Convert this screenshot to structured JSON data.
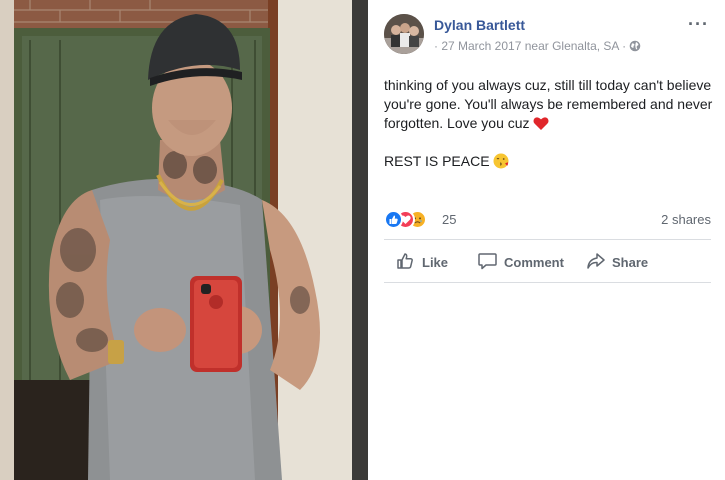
{
  "post": {
    "author": "Dylan Bartlett",
    "meta": "· 27 March 2017 near Glenalta, SA ·",
    "more_label": "···",
    "body": [
      "thinking of you always cuz, still till today can't believe you're gone. You'll always be remembered and never forgotten. Love you cuz",
      "REST IS PEACE"
    ],
    "privacy_icon": "globe-icon",
    "body_emojis": [
      "red-heart-icon",
      "kissing-face-icon"
    ]
  },
  "reactions": {
    "icons": [
      "like-reaction-icon",
      "love-reaction-icon",
      "sad-reaction-icon"
    ],
    "count": "25",
    "shares": "2 shares"
  },
  "actions": {
    "like": "Like",
    "comment": "Comment",
    "share": "Share"
  },
  "colors": {
    "author": "#385898",
    "meta": "#90949c",
    "like_blue": "#1877f2",
    "love_red": "#f33e58",
    "sad_yellow": "#f7b125"
  }
}
